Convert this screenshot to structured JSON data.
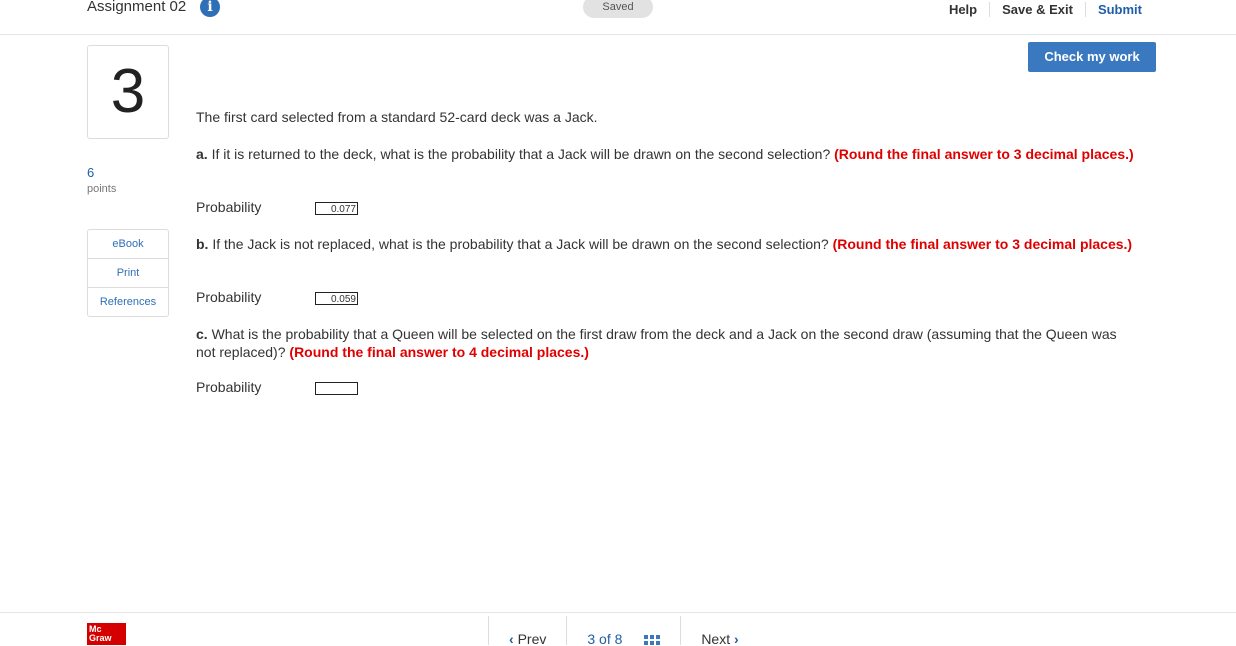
{
  "header": {
    "assignment_title": "Assignment 02",
    "info_glyph": "i",
    "saved_label": "Saved",
    "help_label": "Help",
    "save_exit_label": "Save & Exit",
    "submit_label": "Submit"
  },
  "sidebar": {
    "question_number": "3",
    "points_value": "6",
    "points_label": "points",
    "tools": [
      "eBook",
      "Print",
      "References"
    ]
  },
  "check_button_label": "Check my work",
  "question": {
    "intro": "The first card selected from a standard 52-card deck was a Jack.",
    "parts": [
      {
        "label": "a.",
        "text": " If it is returned to the deck, what is the probability that a Jack will be drawn on the second selection? ",
        "instruction": "(Round the final answer to 3 decimal places.)",
        "answer_label": "Probability",
        "answer_value": "0.077"
      },
      {
        "label": "b.",
        "text": " If the Jack is not replaced, what is the probability that a Jack will be drawn on the second selection? ",
        "instruction": "(Round the final answer to 3 decimal places.)",
        "answer_label": "Probability",
        "answer_value": "0.059"
      },
      {
        "label": "c.",
        "text": " What is the probability that a Queen will be selected on the first draw from the deck and a Jack on the second draw (assuming that the Queen was not replaced)? ",
        "instruction": "(Round the final answer to 4 decimal places.)",
        "answer_label": "Probability",
        "answer_value": ""
      }
    ]
  },
  "footer": {
    "logo_line1": "Mc",
    "logo_line2": "Graw",
    "prev_label": "Prev",
    "page_current": "3",
    "page_of": "of",
    "page_total": "8",
    "next_label": "Next"
  },
  "colors": {
    "accent": "#3a79c0",
    "instruction_red": "#e00000",
    "brand_red": "#d40000"
  }
}
